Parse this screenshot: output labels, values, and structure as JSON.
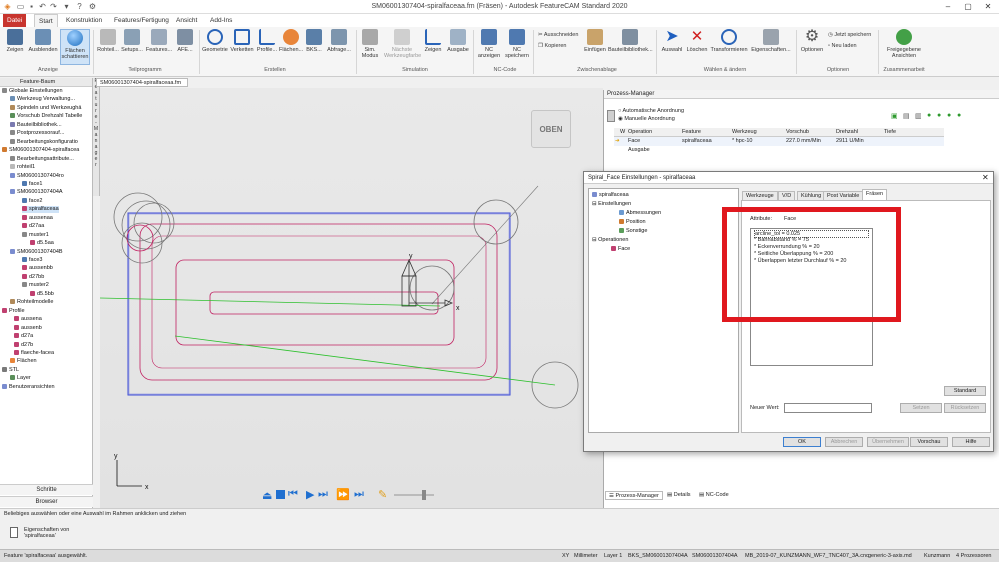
{
  "app": {
    "title": "SM06001307404-spiralfaceaa.fm (Fräsen) - Autodesk FeatureCAM Standard 2020"
  },
  "tabs": [
    "Datei",
    "Start",
    "Konstruktion",
    "Features/Fertigung",
    "Ansicht",
    "Add-Ins"
  ],
  "ribbon": {
    "buttons": [
      {
        "label": "Zeigen",
        "icon": "eye-icon"
      },
      {
        "label": "Ausblenden",
        "icon": "eye-hide-icon"
      },
      {
        "label": "Flächen schattieren",
        "icon": "shaded-sphere-icon"
      },
      {
        "label": "Rohteil...",
        "icon": "stock-icon"
      },
      {
        "label": "Setups...",
        "icon": "setups-icon"
      },
      {
        "label": "Features...",
        "icon": "features-icon"
      },
      {
        "label": "AFE...",
        "icon": "afe-icon"
      },
      {
        "label": "Geometrie",
        "icon": "geometry-icon"
      },
      {
        "label": "Verketten",
        "icon": "chain-icon"
      },
      {
        "label": "Profile...",
        "icon": "profile-icon"
      },
      {
        "label": "Flächen...",
        "icon": "surface-icon"
      },
      {
        "label": "BKS...",
        "icon": "ucs-icon"
      },
      {
        "label": "Abfrage...",
        "icon": "query-icon"
      },
      {
        "label": "Sim. Modus",
        "icon": "sim-mode-icon"
      },
      {
        "label": "Nächste Werkzeugfarbe",
        "icon": "next-tool-color-icon"
      },
      {
        "label": "Zeigen",
        "icon": "chart-icon"
      },
      {
        "label": "Ausgabe",
        "icon": "output-icon"
      },
      {
        "label": "NC anzeigen",
        "icon": "nc-show-icon"
      },
      {
        "label": "NC speichern",
        "icon": "nc-save-icon"
      },
      {
        "label": "Einfügen",
        "icon": "paste-icon"
      },
      {
        "label": "Bauteilbibliothek...",
        "icon": "library-icon"
      },
      {
        "label": "Auswahl",
        "icon": "select-cursor-icon"
      },
      {
        "label": "Löschen",
        "icon": "delete-icon"
      },
      {
        "label": "Transformieren",
        "icon": "transform-icon"
      },
      {
        "label": "Eigenschaften...",
        "icon": "properties-icon"
      },
      {
        "label": "Optionen",
        "icon": "gear-icon"
      },
      {
        "label": "Freigegebene Ansichten",
        "icon": "shared-views-icon"
      }
    ],
    "small": {
      "cut": "Ausschneiden",
      "copy": "Kopieren",
      "save_now": "Jetzt speichern",
      "new_load": "Neu laden"
    },
    "groups": [
      "Anzeige",
      "Teilprogramm",
      "Erstellen",
      "Simulation",
      "NC-Code",
      "Zwischenablage",
      "Wählen & ändern",
      "Optionen",
      "Zusammenarbeit"
    ]
  },
  "feature_tree": {
    "header": "Feature-Baum",
    "items": [
      "Globale Einstellungen",
      "Werkzeug Verwaltung...",
      "Spindeln und Werkzeughä",
      "Vorschub Drehzahl Tabelle",
      "Bauteilbibliothek...",
      "Postprozessorauf...",
      "Bearbeitungskonfiguratio",
      "SM06001307404-spiralfacea",
      "Bearbeitungsattribute...",
      "rohteil1",
      "SM06001307404ro",
      "face1",
      "SM06001307404A",
      "face2",
      "spiralfaceaa",
      "aussenaa",
      "d27aa",
      "muster1",
      "d5.5aa",
      "SM06001307404B",
      "face3",
      "aussenbb",
      "d27bb",
      "muster2",
      "d5.5bb",
      "Rohteilmodelle",
      "Profile",
      "aussena",
      "aussenb",
      "d27a",
      "d27b",
      "flaeche-facea",
      "Flächen",
      "STL",
      "Layer",
      "Benutzeransichten"
    ],
    "buttons": [
      "Schritte",
      "Browser"
    ]
  },
  "side_strip": "Feature-Manager",
  "document_tab": "SM06001307404-spiralfaceaa.fm",
  "view_cube": "OBEN",
  "axes": {
    "y": "y",
    "x": "x"
  },
  "status": {
    "hint": "Beliebiges auswählen oder eine Auswahl im Rahmen anklicken und ziehen",
    "props": "Eigenschaften von 'spiralfaceaa'",
    "selected": "Feature 'spiralfaceaa' ausgewählt.",
    "fields": [
      "XY",
      "Millimeter",
      "Layer 1",
      "BKS_SM06001307404A",
      "SM06001307404A",
      "MB_2019-07_KUNZMANN_WF7_TNC407_3A.cnc",
      "generic-3-axis.md",
      "Kunzmann",
      "4 Prozessoren"
    ]
  },
  "process_manager": {
    "title": "Prozess-Manager",
    "auto": "Automatische Anordnung",
    "manual": "Manuelle Anordnung",
    "columns": [
      "W",
      "Operation",
      "Feature",
      "Werkzeug",
      "Vorschub",
      "Drehzahl",
      "Tiefe"
    ],
    "row": [
      "Face",
      "spiralfaceaa",
      "* hpc-10",
      "227.0 mm/Min",
      "2911 U/Min",
      ""
    ],
    "output": "Ausgabe",
    "tabs": [
      "Prozess-Manager",
      "Details",
      "NC-Code"
    ]
  },
  "dialog": {
    "title": "Spiral_Face Einstellungen - spiralfaceaa",
    "tree": [
      "spiralfaceaa",
      "Einstellungen",
      "Abmessungen",
      "Position",
      "Sonstige",
      "Operationen",
      "Face"
    ],
    "tabs": [
      "Werkzeuge",
      "V/D",
      "Kühlung",
      "Post Variable",
      "Fräsen"
    ],
    "attribute_label": "Attribute:",
    "attribute_value": "Face",
    "attributes": [
      "arcline_tol = 0.025",
      "* Bahnabstand % = 75",
      "* Eckenverrundung % = 20",
      "* Seitliche Überlappung % = 200",
      "* Überlappen letzter Durchlauf % = 20"
    ],
    "standard_button": "Standard",
    "new_value_label": "Neuer Wert:",
    "new_value": "",
    "set_button": "Setzen",
    "reset_button": "Rücksetzen",
    "footer_buttons": [
      "OK",
      "Abbrechen",
      "Übernehmen",
      "Vorschau",
      "Hilfe"
    ]
  },
  "colors": {
    "file_tab": "#c8352e",
    "highlight_box": "#e0181e",
    "stock_outline": "#3d4bd6",
    "profile": "#c02060",
    "toolpath_green": "#2ec02e"
  }
}
